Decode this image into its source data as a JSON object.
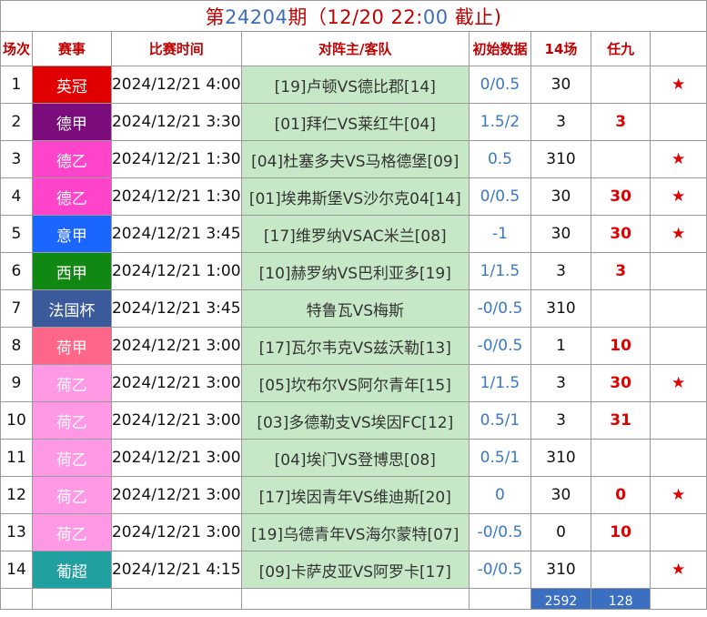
{
  "title": {
    "prefix": "第",
    "issue": "24204",
    "mid": "期（12/20 22:",
    "mins": "00",
    "suffix": " 截止)"
  },
  "headers": [
    "场次",
    "赛事",
    "比赛时间",
    "对阵主/客队",
    "初始数据",
    "14场",
    "任九"
  ],
  "colors": {
    "title": "#c00000",
    "title_number": "#3d6fb6",
    "vs_bg": "#c6e8c6",
    "handicap": "#3a78c4",
    "accent_red": "#e00000",
    "total_bg": "#3a6fc2"
  },
  "rows": [
    {
      "no": "1",
      "league": "英冠",
      "league_bg": "#e00000",
      "time": "2024/12/21 4:00",
      "match": "[19]卢顿VS德比郡[14]",
      "handicap": "0/0.5",
      "c14": "30",
      "r9": "",
      "star": "★"
    },
    {
      "no": "2",
      "league": "德甲",
      "league_bg": "#7b0c7b",
      "time": "2024/12/21 3:30",
      "match": "[01]拜仁VS莱红牛[04]",
      "handicap": "1.5/2",
      "c14": "3",
      "r9": "3",
      "star": ""
    },
    {
      "no": "3",
      "league": "德乙",
      "league_bg": "#ff44cc",
      "time": "2024/12/21 1:30",
      "match": "[04]杜塞多夫VS马格德堡[09]",
      "handicap": "0.5",
      "c14": "310",
      "r9": "",
      "star": "★"
    },
    {
      "no": "4",
      "league": "德乙",
      "league_bg": "#ff44cc",
      "time": "2024/12/21 1:30",
      "match": "[01]埃弗斯堡VS沙尔克04[14]",
      "handicap": "0/0.5",
      "c14": "30",
      "r9": "30",
      "star": "★"
    },
    {
      "no": "5",
      "league": "意甲",
      "league_bg": "#1a66ff",
      "time": "2024/12/21 3:45",
      "match": "[17]维罗纳VSAC米兰[08]",
      "handicap": "-1",
      "c14": "30",
      "r9": "30",
      "star": "★"
    },
    {
      "no": "6",
      "league": "西甲",
      "league_bg": "#118811",
      "time": "2024/12/21 1:00",
      "match": "[10]赫罗纳VS巴利亚多[19]",
      "handicap": "1/1.5",
      "c14": "3",
      "r9": "3",
      "star": ""
    },
    {
      "no": "7",
      "league": "法国杯",
      "league_bg": "#3a5a9c",
      "time": "2024/12/21 3:45",
      "match": "特鲁瓦VS梅斯",
      "handicap": "-0/0.5",
      "c14": "310",
      "r9": "",
      "star": ""
    },
    {
      "no": "8",
      "league": "荷甲",
      "league_bg": "#ff6688",
      "time": "2024/12/21 3:00",
      "match": "[17]瓦尔韦克VS兹沃勒[13]",
      "handicap": "-0/0.5",
      "c14": "1",
      "r9": "10",
      "star": ""
    },
    {
      "no": "9",
      "league": "荷乙",
      "league_bg": "#ff99e6",
      "time": "2024/12/21 3:00",
      "match": "[05]坎布尔VS阿尔青年[15]",
      "handicap": "1/1.5",
      "c14": "3",
      "r9": "30",
      "star": "★"
    },
    {
      "no": "10",
      "league": "荷乙",
      "league_bg": "#ff99e6",
      "time": "2024/12/21 3:00",
      "match": "[03]多德勒支VS埃因FC[12]",
      "handicap": "0.5/1",
      "c14": "3",
      "r9": "31",
      "star": ""
    },
    {
      "no": "11",
      "league": "荷乙",
      "league_bg": "#ff99e6",
      "time": "2024/12/21 3:00",
      "match": "[04]埃门VS登博思[08]",
      "handicap": "0.5/1",
      "c14": "310",
      "r9": "",
      "star": ""
    },
    {
      "no": "12",
      "league": "荷乙",
      "league_bg": "#ff99e6",
      "time": "2024/12/21 3:00",
      "match": "[17]埃因青年VS维迪斯[20]",
      "handicap": "0",
      "c14": "30",
      "r9": "0",
      "star": "★"
    },
    {
      "no": "13",
      "league": "荷乙",
      "league_bg": "#ff99e6",
      "time": "2024/12/21 3:00",
      "match": "[19]乌德青年VS海尔蒙特[07]",
      "handicap": "-0/0.5",
      "c14": "0",
      "r9": "10",
      "star": ""
    },
    {
      "no": "14",
      "league": "葡超",
      "league_bg": "#20a0a0",
      "time": "2024/12/21 4:15",
      "match": "[09]卡萨皮亚VS阿罗卡[17]",
      "handicap": "-0/0.5",
      "c14": "310",
      "r9": "",
      "star": "★"
    }
  ],
  "totals": {
    "c14": "2592",
    "r9": "128"
  }
}
